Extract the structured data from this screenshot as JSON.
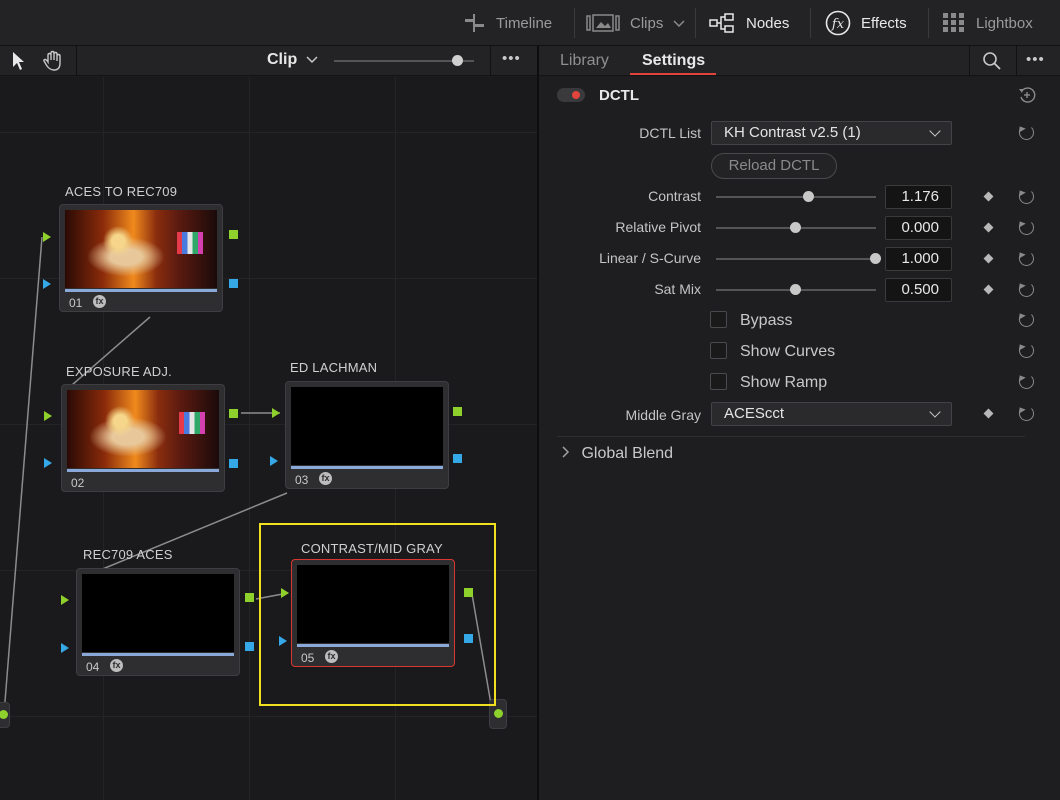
{
  "topbar": {
    "timeline": "Timeline",
    "clips": "Clips",
    "nodes": "Nodes",
    "effects": "Effects",
    "lightbox": "Lightbox"
  },
  "node_toolbar": {
    "mode": "Clip",
    "more": "•••"
  },
  "nodes": [
    {
      "label": "ACES TO REC709",
      "num": "01",
      "fx": "fx"
    },
    {
      "label": "EXPOSURE ADJ.",
      "num": "02"
    },
    {
      "label": "ED LACHMAN",
      "num": "03",
      "fx": "fx"
    },
    {
      "label": "REC709 ACES",
      "num": "04",
      "fx": "fx"
    },
    {
      "label": "CONTRAST/MID GRAY",
      "num": "05",
      "fx": "fx"
    }
  ],
  "colors": {
    "accent_red": "#e0443c",
    "selection_yellow": "#f0e020",
    "input_green": "#8ed12c",
    "input_blue": "#35a8e8"
  },
  "panel": {
    "tabs": {
      "library": "Library",
      "settings": "Settings"
    },
    "more": "•••",
    "section_title": "DCTL",
    "dctl_list_label": "DCTL List",
    "dctl_list_value": "KH Contrast v2.5 (1)",
    "reload_label": "Reload DCTL",
    "params": [
      {
        "label": "Contrast",
        "value": "1.176",
        "level": 0.58
      },
      {
        "label": "Relative Pivot",
        "value": "0.000",
        "level": 0.5
      },
      {
        "label": "Linear / S-Curve",
        "value": "1.000",
        "level": 1.0
      },
      {
        "label": "Sat Mix",
        "value": "0.500",
        "level": 0.5
      }
    ],
    "checkboxes": [
      "Bypass",
      "Show Curves",
      "Show Ramp"
    ],
    "middle_gray_label": "Middle Gray",
    "middle_gray_value": "ACEScct",
    "global_blend": "Global Blend"
  }
}
